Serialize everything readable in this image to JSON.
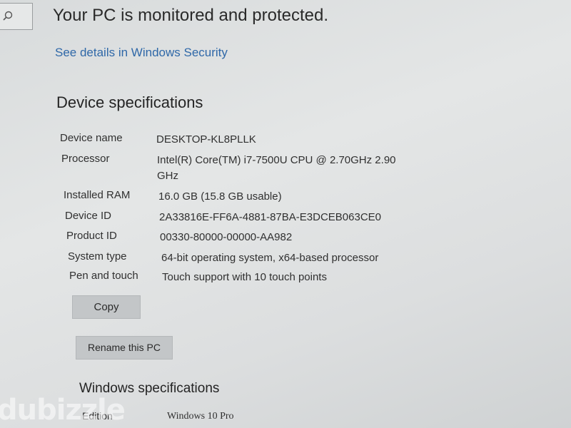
{
  "header": {
    "status_text": "Your PC is monitored and protected.",
    "link_text": "See details in Windows Security"
  },
  "device_specs": {
    "title": "Device specifications",
    "rows": [
      {
        "label": "Device name",
        "value": "DESKTOP-KL8PLLK"
      },
      {
        "label": "Processor",
        "value": "Intel(R) Core(TM) i7-7500U CPU @ 2.70GHz   2.90",
        "value_cont": "GHz"
      },
      {
        "label": "Installed RAM",
        "value": "16.0 GB (15.8 GB usable)"
      },
      {
        "label": "Device ID",
        "value": "2A33816E-FF6A-4881-87BA-E3DCEB063CE0"
      },
      {
        "label": "Product ID",
        "value": "00330-80000-00000-AA982"
      },
      {
        "label": "System type",
        "value": "64-bit operating system, x64-based processor"
      },
      {
        "label": "Pen and touch",
        "value": "Touch support with 10 touch points"
      }
    ],
    "copy_label": "Copy",
    "rename_label": "Rename this PC"
  },
  "windows_specs": {
    "title": "Windows specifications",
    "rows": [
      {
        "label": "Edition",
        "value": "Windows 10 Pro"
      }
    ]
  },
  "watermark": "dubizzle",
  "icons": {
    "search": "search-icon"
  }
}
